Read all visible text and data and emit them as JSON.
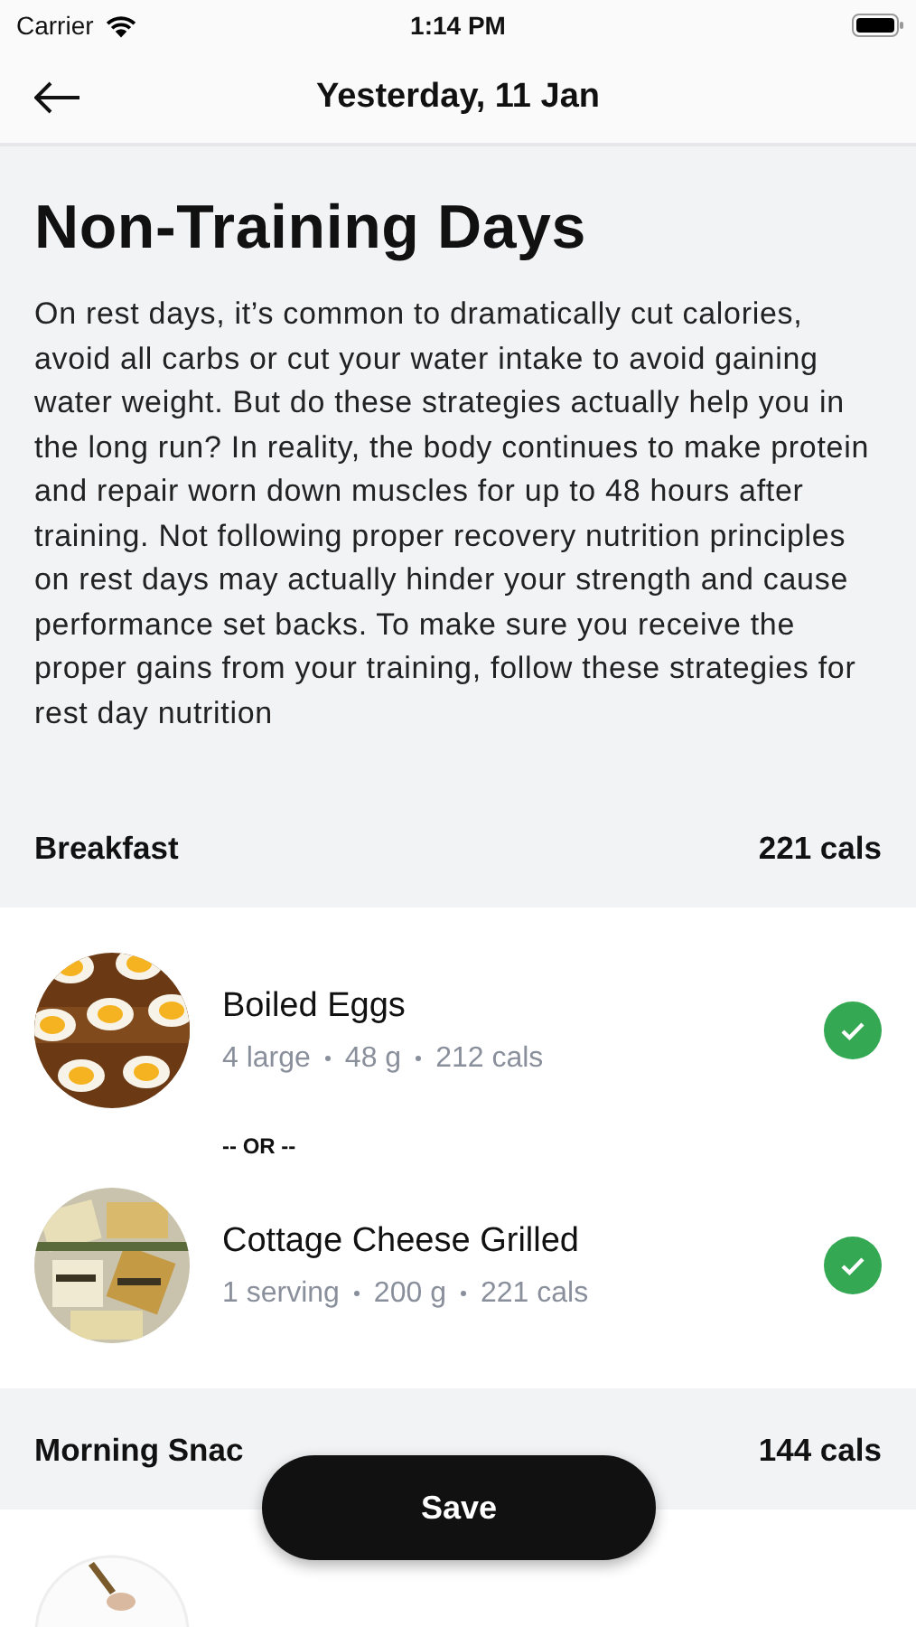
{
  "status_bar": {
    "carrier": "Carrier",
    "time": "1:14 PM"
  },
  "nav": {
    "title": "Yesterday, 11 Jan"
  },
  "article": {
    "title": "Non-Training Days",
    "body": "On rest days, it’s common to dramatically cut calories, avoid all carbs or cut your water intake to avoid gaining water weight. But do these strategies actually help you in the long run? In reality, the body continues to make protein and repair worn down muscles for up to 48 hours after training. Not following proper recovery nutrition principles on rest days may actually hinder your strength and cause performance set backs. To make sure you receive the proper gains from your training, follow these strategies for rest day nutrition"
  },
  "meals": [
    {
      "name": "Breakfast",
      "calories": "221 cals",
      "items": [
        {
          "kind": "food",
          "name": "Boiled Eggs",
          "details": [
            "4 large",
            "48 g",
            "212 cals"
          ],
          "checked": true
        },
        {
          "kind": "separator",
          "label": "-- OR --"
        },
        {
          "kind": "food",
          "name": "Cottage Cheese Grilled",
          "details": [
            "1 serving",
            "200 g",
            "221 cals"
          ],
          "checked": true
        }
      ]
    },
    {
      "name": "Morning Snac",
      "calories": "144 cals",
      "items": [
        {
          "kind": "partial"
        }
      ]
    }
  ],
  "save_button": {
    "label": "Save"
  }
}
